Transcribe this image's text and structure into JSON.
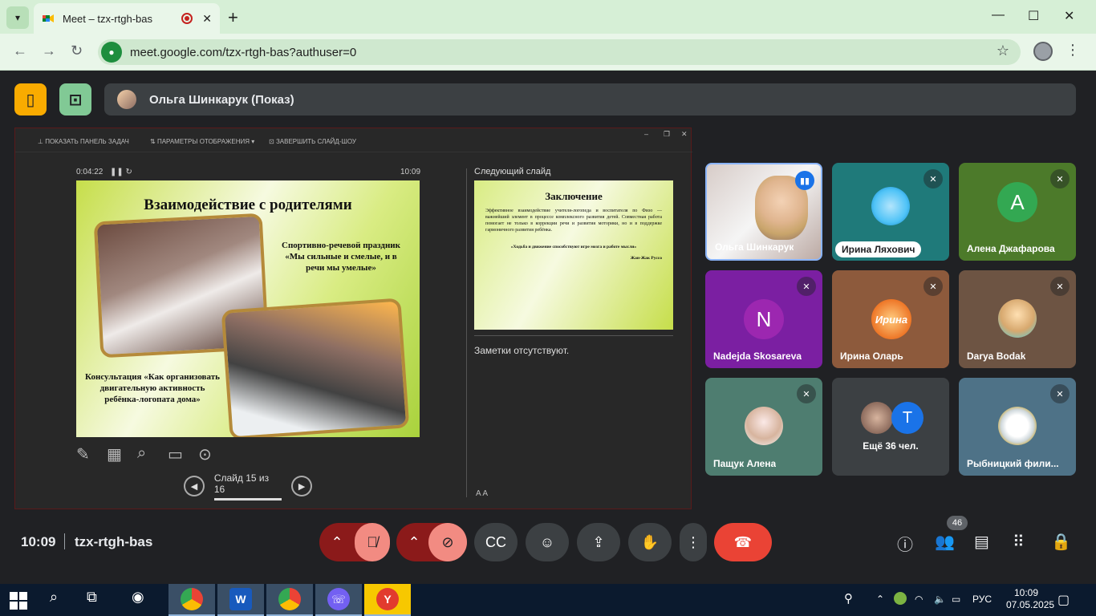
{
  "browser": {
    "tab_title": "Meet – tzx-rtgh-bas",
    "url": "meet.google.com/tzx-rtgh-bas?authuser=0",
    "new_tab_label": "+",
    "minimize": "—",
    "maximize": "☐",
    "close": "✕"
  },
  "meet": {
    "presenter_label": "Ольга Шинкарук (Показ)",
    "clock": "10:09",
    "meeting_code": "tzx-rtgh-bas",
    "participants_count": "46",
    "more_people": "Ещё 36 чел."
  },
  "shared_screen": {
    "toolbar": {
      "show_taskbar": "ПОКАЗАТЬ ПАНЕЛЬ ЗАДАЧ",
      "display_settings": "ПАРАМЕТРЫ ОТОБРАЖЕНИЯ ▾",
      "end_show": "ЗАВЕРШИТЬ СЛАЙД-ШОУ"
    },
    "elapsed": "0:04:22",
    "time": "10:09",
    "slide_title": "Взаимодействие с родителями",
    "caption_1": "Спортивно-речевой праздник «Мы сильные и смелые, и в речи мы умелые»",
    "caption_2": "Консультация «Как организовать двигательную активность ребёнка-логопата дома»",
    "slide_counter": "Слайд 15 из 16",
    "next_slide_label": "Следующий слайд",
    "next_title": "Заключение",
    "next_body": "Эффективное взаимодействие учителя-логопеда и воспитателя по Физо — важнейший элемент в процессе комплексного развития детей. Совместная работа помогает не только в коррекции речи и развития моторики, но и в поддержке гармоничного развития ребёнка.",
    "next_quote": "«Ходьба и движение способствуют игре мозга и работе мысли»",
    "next_author": "Жан-Жак Руссо",
    "notes": "Заметки отсутствуют.",
    "font_controls": "A  A"
  },
  "participants": [
    {
      "name": "Ольга Шинкарук",
      "kind": "video",
      "muted": false
    },
    {
      "name": "Ирина Ляхович",
      "kind": "photo",
      "muted": true
    },
    {
      "name": "Алена Джафарова",
      "kind": "letter",
      "letter": "A",
      "muted": true
    },
    {
      "name": "Nadejda Skosareva",
      "kind": "letter",
      "letter": "N",
      "muted": true
    },
    {
      "name": "Ирина Оларь",
      "kind": "photo",
      "muted": true
    },
    {
      "name": "Darya Bodak",
      "kind": "photo",
      "muted": true
    },
    {
      "name": "Пащук Алена",
      "kind": "photo",
      "muted": true
    },
    {
      "name": "Рыбницкий фили...",
      "kind": "photo",
      "muted": true
    }
  ],
  "more_tile_letter": "T",
  "tile_letter_olar": "Ирина",
  "taskbar": {
    "lang": "РУС",
    "time": "10:09",
    "date": "07.05.2025"
  },
  "colors": {
    "meet_bg": "#202124",
    "end_call": "#ea4335",
    "muted_ctrl": "#8b1a1a",
    "chrome_tab_bg": "#d6efd6"
  }
}
